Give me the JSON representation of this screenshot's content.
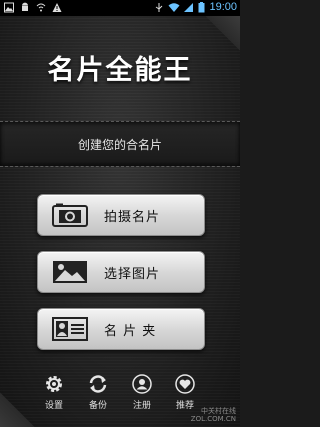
{
  "status_bar": {
    "time": "19:00",
    "icons": [
      "gallery-icon",
      "android-icon",
      "wifi-alert-icon",
      "warning-icon",
      "usb-icon",
      "wifi-icon",
      "signal-icon",
      "battery-icon"
    ]
  },
  "app": {
    "title": "名片全能王",
    "subtitle": "创建您的合名片"
  },
  "buttons": [
    {
      "label": "拍摄名片",
      "icon": "camera-icon"
    },
    {
      "label": "选择图片",
      "icon": "picture-icon"
    },
    {
      "label": "名 片 夹",
      "icon": "contact-card-icon"
    }
  ],
  "bottom_nav": [
    {
      "label": "设置",
      "icon": "gear-icon"
    },
    {
      "label": "备份",
      "icon": "sync-icon"
    },
    {
      "label": "注册",
      "icon": "user-icon"
    },
    {
      "label": "推荐",
      "icon": "heart-icon"
    }
  ],
  "watermark": {
    "line1": "中关村在线",
    "line2": "ZOL.COM.CN"
  }
}
